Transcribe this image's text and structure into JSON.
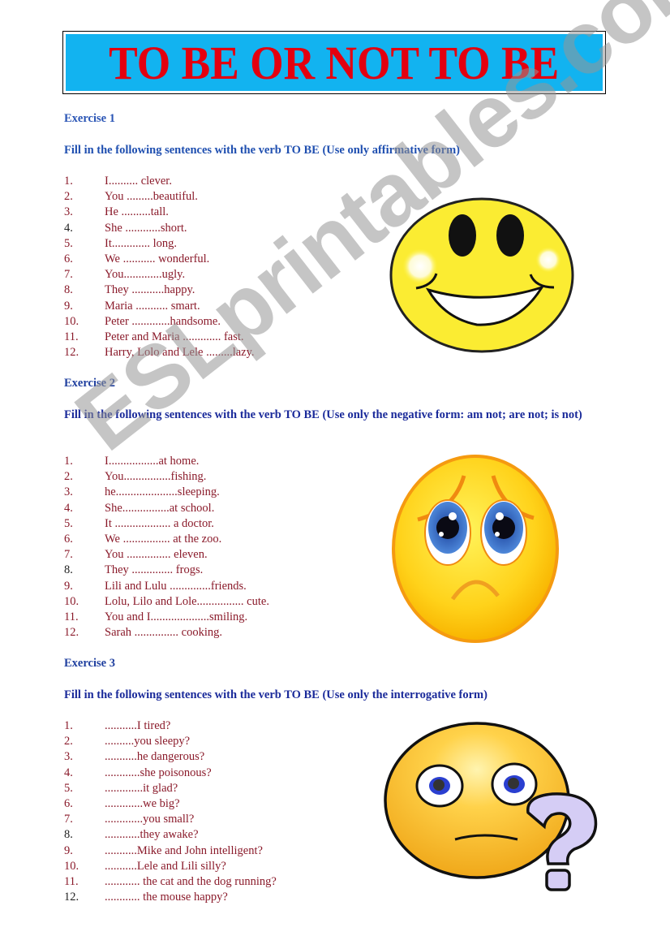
{
  "title": "TO BE OR NOT TO BE",
  "watermark": "ESLprintables.com",
  "colors": {
    "banner_bg": "#12b3f0",
    "banner_text": "#e3000f",
    "heading": "#1f3f9f",
    "sentence_text": "#8a1a2a"
  },
  "exercises": [
    {
      "heading": "Exercise 1",
      "instruction": "Fill in the following sentences with the verb TO BE (Use only affirmative form)",
      "image": "happy-smiley-face",
      "items": [
        {
          "num": "1.",
          "text": "I.......... clever."
        },
        {
          "num": "2.",
          "text": "You .........beautiful."
        },
        {
          "num": "3.",
          "text": "He ..........tall."
        },
        {
          "num": "4.",
          "text": "She ............short."
        },
        {
          "num": "5.",
          "text": "It............. long."
        },
        {
          "num": "6.",
          "text": "We ........... wonderful."
        },
        {
          "num": "7.",
          "text": "You.............ugly."
        },
        {
          "num": "8.",
          "text": "They ...........happy."
        },
        {
          "num": "9.",
          "text": "Maria ........... smart."
        },
        {
          "num": "10.",
          "text": "Peter .............handsome."
        },
        {
          "num": "11.",
          "text": "Peter and Maria ............. fast."
        },
        {
          "num": "12.",
          "text": "Harry, Lolo and Lele .........lazy."
        }
      ]
    },
    {
      "heading": "Exercise 2",
      "instruction": "Fill in the following sentences with the verb TO BE (Use only the negative form:  am not;  are not;  is not)",
      "image": "sad-face",
      "items": [
        {
          "num": "1.",
          "text": "I.................at home."
        },
        {
          "num": "2.",
          "text": "You................fishing."
        },
        {
          "num": "3.",
          "text": "he.....................sleeping."
        },
        {
          "num": "4.",
          "text": "She................at school."
        },
        {
          "num": "5.",
          "text": "It ................... a doctor."
        },
        {
          "num": "6.",
          "text": "We ................ at the zoo."
        },
        {
          "num": "7.",
          "text": "You ............... eleven."
        },
        {
          "num": "8.",
          "text": "They .............. frogs."
        },
        {
          "num": "9.",
          "text": " Lili and Lulu ..............friends."
        },
        {
          "num": "10.",
          "text": "Lolu, Lilo and Lole................ cute."
        },
        {
          "num": "11.",
          "text": "You and I....................smiling."
        },
        {
          "num": "12.",
          "text": " Sarah ............... cooking."
        }
      ]
    },
    {
      "heading": "Exercise 3",
      "instruction": "Fill in the following sentences with the verb TO BE (Use only the interrogative form)",
      "image": "confused-face-question-mark",
      "items": [
        {
          "num": "1.",
          "text": "...........I tired?"
        },
        {
          "num": "2.",
          "text": "..........you sleepy?"
        },
        {
          "num": "3.",
          "text": "...........he dangerous?"
        },
        {
          "num": "4.",
          "text": "............she poisonous?"
        },
        {
          "num": "5.",
          "text": ".............it glad?"
        },
        {
          "num": "6.",
          "text": ".............we big?"
        },
        {
          "num": "7.",
          "text": ".............you small?"
        },
        {
          "num": "8.",
          "text": "............they awake?"
        },
        {
          "num": "9.",
          "text": "...........Mike and John intelligent?"
        },
        {
          "num": "10.",
          "text": "...........Lele and Lili silly?"
        },
        {
          "num": "11.",
          "text": "............ the cat and the dog running?"
        },
        {
          "num": "12.",
          "text": "............ the mouse happy?"
        }
      ]
    }
  ]
}
